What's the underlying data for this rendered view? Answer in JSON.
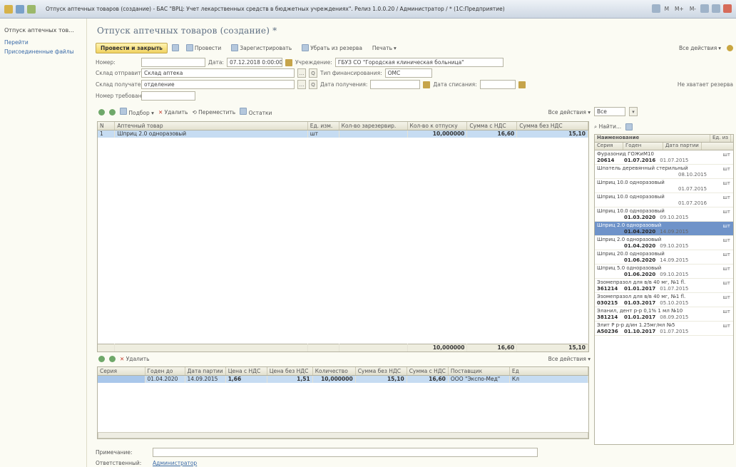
{
  "window": {
    "title": "Отпуск аптечных товаров (создание) - БАС \"ВРЦ: Учет лекарственных средств в бюджетных учреждениях\". Релиз 1.0.0.20 / Администратор / * (1С:Предприятие)",
    "right_items": [
      "M",
      "M+",
      "M-"
    ]
  },
  "sidebar": {
    "title": "Отпуск аптечных тов...",
    "items": [
      "Перейти",
      "Присоединенные файлы"
    ]
  },
  "form": {
    "title": "Отпуск аптечных товаров (создание) *",
    "toolbar": {
      "post_close": "Провести и закрыть",
      "post": "Провести",
      "register": "Зарегистрировать",
      "take_reserve": "Убрать из резерва",
      "print": "Печать",
      "all_actions": "Все действия"
    },
    "fields": {
      "number_label": "Номер:",
      "number_value": "",
      "date_label": "Дата:",
      "date_value": "07.12.2018 0:00:00",
      "org_label": "Учреждение:",
      "org_value": "ГБУЗ СО \"Городская клиническая больница\"",
      "warehouse_from_label": "Склад отправитель:",
      "warehouse_from_value": "Склад аптека",
      "funding_label": "Тип финансирования:",
      "funding_value": "ОМС",
      "warehouse_to_label": "Склад получатель:",
      "warehouse_to_value": "отделение",
      "receipt_date_label": "Дата получения:",
      "receipt_date_value": "",
      "write_off_date_label": "Дата списания:",
      "write_off_date_value": "",
      "template_label": "Номер требования:",
      "template_value": "",
      "right_note": "Не хватает резерва"
    },
    "table_toolbar": {
      "pick": "Подбор",
      "delete": "Удалить",
      "move": "Переместить",
      "remains": "Остатки",
      "all_actions": "Все действия",
      "filter_value": "Все"
    },
    "main_table": {
      "headers": [
        "N",
        "Аптечный товар",
        "Ед. изм.",
        "Кол-во зарезервир.",
        "Кол-во к отпуску",
        "Сумма с НДС",
        "Сумма без НДС"
      ],
      "rows": [
        {
          "n": "1",
          "item": "Шприц 2.0 одноразовый",
          "unit": "шт",
          "reserved": "",
          "qty": "10,000000",
          "sum_vat": "16,60",
          "sum_novat": "15,10"
        }
      ],
      "totals": {
        "qty": "10,000000",
        "sum_vat": "16,60",
        "sum_novat": "15,10"
      }
    },
    "sub_toolbar": {
      "delete": "Удалить",
      "all_actions": "Все действия"
    },
    "sub_table": {
      "headers": [
        "Серия",
        "Годен до",
        "Дата партии",
        "Цена с НДС",
        "Цена без НДС",
        "Количество",
        "Сумма без НДС",
        "Сумма с НДС",
        "Поставщик",
        "Ед"
      ],
      "rows": [
        {
          "series": "",
          "valid": "01.04.2020",
          "batch": "14.09.2015",
          "price_vat": "1,66",
          "price_novat": "1,51",
          "qty": "10,000000",
          "sum_novat": "15,10",
          "sum_vat": "16,60",
          "supplier": "ООО \"Экспо-Мед\"",
          "unit": "Кл"
        }
      ]
    },
    "right_panel": {
      "search": "Найти...",
      "headers": [
        "Наименование",
        "Ед. из"
      ],
      "sub_headers": [
        "Серия",
        "Годен",
        "Дата партии"
      ],
      "items": [
        {
          "name": "Фуразонид ГОЖиМ10",
          "unit": "шт",
          "series": "20614",
          "valid": "01.07.2016",
          "date": "01.07.2015"
        },
        {
          "name": "Шпатель деревянный стерильный",
          "unit": "шт",
          "series": "",
          "valid": "",
          "date": "08.10.2015"
        },
        {
          "name": "Шприц 10.0 одноразовый",
          "unit": "шт",
          "series": "",
          "valid": "",
          "date": "01.07.2015"
        },
        {
          "name": "Шприц 10.0 одноразовый",
          "unit": "шт",
          "series": "",
          "valid": "",
          "date": "01.07.2016"
        },
        {
          "name": "Шприц 10.0 одноразовый",
          "unit": "шт",
          "series": "",
          "valid": "01.03.2020",
          "date": "09.10.2015"
        },
        {
          "name": "Шприц 2.0 одноразовый",
          "unit": "шт",
          "series": "",
          "valid": "01.04.2020",
          "date": "14.09.2015"
        },
        {
          "name": "Шприц 2.0 одноразовый",
          "unit": "шт",
          "series": "",
          "valid": "01.04.2020",
          "date": "09.10.2015"
        },
        {
          "name": "Шприц 20.0 одноразовый",
          "unit": "шт",
          "series": "",
          "valid": "01.06.2020",
          "date": "14.09.2015"
        },
        {
          "name": "Шприц 5.0 одноразовый",
          "unit": "шт",
          "series": "",
          "valid": "01.06.2020",
          "date": "09.10.2015"
        },
        {
          "name": "Эзомепразол для в/в 40 мг, №1 fl.",
          "unit": "шт",
          "series": "361214",
          "valid": "01.01.2017",
          "date": "01.07.2015"
        },
        {
          "name": "Эзомепразол для в/в 40 мг, №1 fl.",
          "unit": "шт",
          "series": "030215",
          "valid": "01.03.2017",
          "date": "05.10.2015"
        },
        {
          "name": "Эланил, дент р-р 0,1% 1 мл №10",
          "unit": "шт",
          "series": "381214",
          "valid": "01.01.2017",
          "date": "08.09.2015"
        },
        {
          "name": "Элит Р р-р д/ин 1.25мг/мл №5",
          "unit": "шт",
          "series": "A50236",
          "valid": "01.10.2017",
          "date": "01.07.2015"
        }
      ]
    },
    "comment_label": "Примечание:",
    "comment_placeholder": "",
    "responsible_label": "Ответственный:",
    "responsible_value": "Администратор"
  }
}
